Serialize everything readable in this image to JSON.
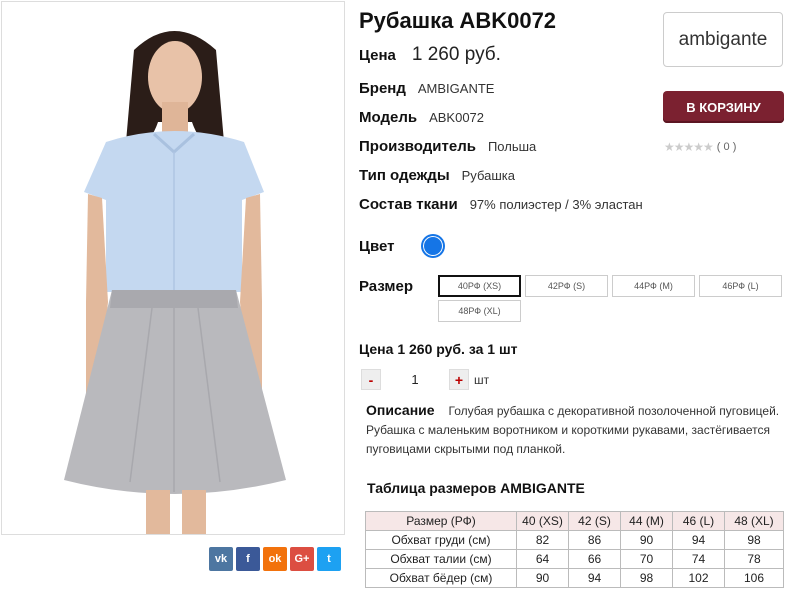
{
  "product": {
    "title": "Рубашка ABK0072",
    "price_label": "Цена",
    "price": "1 260 руб.",
    "brand_logo_text": "ambigante",
    "cart_button": "В КОРЗИНУ",
    "rating": {
      "stars": "★★★★★",
      "count": "( 0 )"
    }
  },
  "attributes": [
    {
      "label": "Бренд",
      "value": "AMBIGANTE"
    },
    {
      "label": "Модель",
      "value": "ABK0072"
    },
    {
      "label": "Производитель",
      "value": "Польша"
    },
    {
      "label": "Тип одежды",
      "value": "Рубашка"
    },
    {
      "label": "Состав ткани",
      "value": "97% полиэстер / 3% эластан"
    }
  ],
  "color": {
    "label": "Цвет",
    "swatch": "#1575e6"
  },
  "size": {
    "label": "Размер",
    "options": [
      "40РФ (XS)",
      "42РФ (S)",
      "44РФ (M)",
      "46РФ (L)",
      "48РФ (XL)"
    ],
    "selected": "40РФ (XS)"
  },
  "order": {
    "per_unit": "Цена 1 260 руб. за 1 шт",
    "minus": "-",
    "plus": "+",
    "quantity": "1",
    "unit": "шт"
  },
  "description": {
    "label": "Описание",
    "text": "Голубая рубашка с декоративной позолоченной пуговицей. Рубашка с маленьким воротником и короткими рукавами, застёгивается пуговицами скрытыми под планкой."
  },
  "size_table": {
    "title": "Таблица размеров AMBIGANTE",
    "headers": [
      "Размер (РФ)",
      "40 (XS)",
      "42 (S)",
      "44 (M)",
      "46 (L)",
      "48 (XL)"
    ],
    "rows": [
      [
        "Обхват груди (см)",
        "82",
        "86",
        "90",
        "94",
        "98"
      ],
      [
        "Обхват талии (см)",
        "64",
        "66",
        "70",
        "74",
        "78"
      ],
      [
        "Обхват бёдер (см)",
        "90",
        "94",
        "98",
        "102",
        "106"
      ]
    ]
  },
  "social": {
    "vk": "vk",
    "fb": "f",
    "ok": "ok",
    "gp": "G+",
    "tw": "t"
  },
  "colors": {
    "accent": "#7b2130",
    "swatch": "#1575e6",
    "table_header": "#f6e7e7"
  }
}
